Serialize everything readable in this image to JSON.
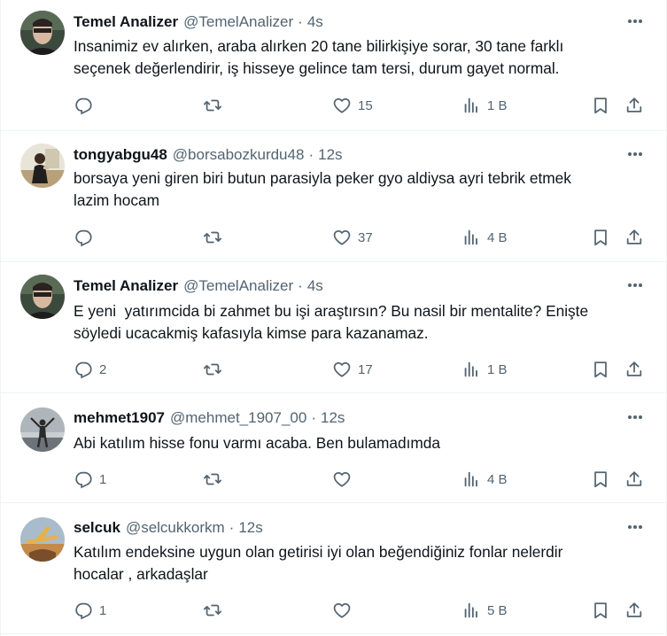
{
  "tweets": [
    {
      "name": "Temel Analizer",
      "handle": "@TemelAnalizer",
      "time": "4s",
      "lines": [
        "Insanimiz ev alırken, araba alırken 20 tane bilirkişiye sorar, 30 tane farklı",
        "seçenek değerlendirir, iş hisseye gelince tam tersi, durum gayet normal."
      ],
      "replies": "",
      "likes": "15",
      "views": "1 B"
    },
    {
      "name": "tongyabgu48",
      "handle": "@borsabozkurdu48",
      "time": "12s",
      "lines": [
        "borsaya yeni giren biri butun parasiyla peker gyo aldiysa ayri tebrik etmek",
        "lazim hocam"
      ],
      "replies": "",
      "likes": "37",
      "views": "4 B"
    },
    {
      "name": "Temel Analizer",
      "handle": "@TemelAnalizer",
      "time": "4s",
      "lines": [
        "E yeni  yatırımcida bi zahmet bu işi araştırsın? Bu nasil bir mentalite? Enişte",
        "söyledi ucacakmiş kafasıyla kimse para kazanamaz."
      ],
      "replies": "2",
      "likes": "17",
      "views": "1 B"
    },
    {
      "name": "mehmet1907",
      "handle": "@mehmet_1907_00",
      "time": "12s",
      "lines": [
        "Abi katılım hisse fonu varmı acaba. Ben bulamadımda"
      ],
      "replies": "1",
      "likes": "",
      "views": "4 B"
    },
    {
      "name": "selcuk",
      "handle": "@selcukkorkm",
      "time": "12s",
      "lines": [
        "Katılım endeksine uygun olan getirisi iyi olan beğendiğiniz fonlar nelerdir",
        "hocalar , arkadaşlar"
      ],
      "replies": "1",
      "likes": "",
      "views": "5 B"
    }
  ],
  "separator": "·",
  "icons": {
    "reply": "reply-icon",
    "retweet": "retweet-icon",
    "like": "like-icon",
    "views": "views-icon",
    "bookmark": "bookmark-icon",
    "share": "share-icon",
    "more": "more-icon"
  },
  "colors": {
    "text": "#0f1419",
    "muted": "#536471",
    "border": "#eff3f4"
  }
}
